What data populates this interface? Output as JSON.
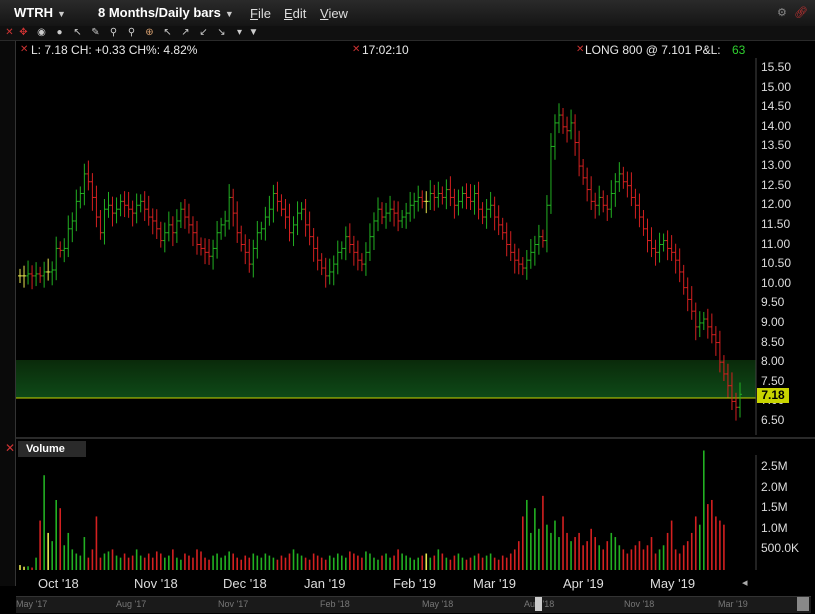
{
  "window": {
    "symbol": "WTRH",
    "period": "8 Months/Daily bars",
    "menus": [
      "File",
      "Edit",
      "View"
    ]
  },
  "toolbar": {
    "icons": [
      "close-icon",
      "crosshair-icon",
      "zoom-icon",
      "circle-icon",
      "cursor-icon",
      "draw-icon",
      "search-icon",
      "search-minus-icon",
      "globe-icon",
      "arrow-icon",
      "arrow-icon",
      "arrow-icon",
      "arrow-icon",
      "dropdown-icon"
    ]
  },
  "infobar": {
    "last": "L: 7.18 CH: +0.33 CH%: 4.82%",
    "time": "17:02:10",
    "position": "LONG 800 @ 7.101 P&L:",
    "pnl": "63"
  },
  "price_axis": [
    "15.50",
    "15.00",
    "14.50",
    "14.00",
    "13.50",
    "13.00",
    "12.50",
    "12.00",
    "11.50",
    "11.00",
    "10.50",
    "10.00",
    "9.50",
    "9.00",
    "8.50",
    "8.00",
    "7.50",
    "7.00",
    "6.50"
  ],
  "last_price_tag": "7.18",
  "volume": {
    "title": "Volume",
    "axis": [
      "2.5M",
      "2.0M",
      "1.5M",
      "1.0M",
      "500.0K"
    ]
  },
  "months": [
    "Oct '18",
    "Nov '18",
    "Dec '18",
    "Jan '19",
    "Feb '19",
    "Mar '19",
    "Apr '19",
    "May '19"
  ],
  "navigator_labels": [
    "May '17",
    "Aug '17",
    "Nov '17",
    "Feb '18",
    "May '18",
    "Aug '18",
    "Nov '18",
    "Mar '19"
  ],
  "colors": {
    "up": "#22b022",
    "down": "#d42020",
    "neutral": "#e8e850",
    "pnl": "#2fd02f",
    "highlight": "#c8d400"
  },
  "chart_data": {
    "type": "candlestick",
    "ylim": [
      6.4,
      15.7
    ],
    "close": [
      10.2,
      10.2,
      10.25,
      10.2,
      10.25,
      10.2,
      10.3,
      10.3,
      10.35,
      10.9,
      10.85,
      10.9,
      11.4,
      11.6,
      12.1,
      12.3,
      12.8,
      12.6,
      12.2,
      11.7,
      11.3,
      11.9,
      12.0,
      11.8,
      11.9,
      12.1,
      12.0,
      11.9,
      11.8,
      12.0,
      12.1,
      11.9,
      11.7,
      11.6,
      11.4,
      11.1,
      11.3,
      11.5,
      11.3,
      11.6,
      11.9,
      11.7,
      11.5,
      11.3,
      11.0,
      10.9,
      10.8,
      10.7,
      10.9,
      11.3,
      11.5,
      11.6,
      12.2,
      11.8,
      11.3,
      11.0,
      10.8,
      10.5,
      10.9,
      11.3,
      11.4,
      11.7,
      11.9,
      12.3,
      12.1,
      11.9,
      11.7,
      11.3,
      11.5,
      11.8,
      11.9,
      11.5,
      11.2,
      10.9,
      10.6,
      10.4,
      10.2,
      10.3,
      10.5,
      10.8,
      10.9,
      11.2,
      11.0,
      10.8,
      10.6,
      10.5,
      10.8,
      11.2,
      11.6,
      11.9,
      11.7,
      11.8,
      11.9,
      11.8,
      11.6,
      11.7,
      11.8,
      12.0,
      12.1,
      12.2,
      12.1,
      12.1,
      12.3,
      12.2,
      12.3,
      12.2,
      12.4,
      12.2,
      12.0,
      12.1,
      12.3,
      12.2,
      12.1,
      12.3,
      11.9,
      11.7,
      11.9,
      12.0,
      11.7,
      11.5,
      11.3,
      11.0,
      10.8,
      10.6,
      10.5,
      10.4,
      10.6,
      10.8,
      11.0,
      11.2,
      11.1,
      12.0,
      13.5,
      14.1,
      14.3,
      14.0,
      13.9,
      14.1,
      13.6,
      13.0,
      12.7,
      12.4,
      12.1,
      12.0,
      12.2,
      12.0,
      11.9,
      12.3,
      12.6,
      12.8,
      12.6,
      12.5,
      12.2,
      12.0,
      11.7,
      11.4,
      11.1,
      10.9,
      10.8,
      11.0,
      11.1,
      10.9,
      10.8,
      10.6,
      10.3,
      9.9,
      9.6,
      9.3,
      8.9,
      9.0,
      9.1,
      8.9,
      8.7,
      8.5,
      8.0,
      7.7,
      7.4,
      7.0,
      6.85,
      7.18
    ],
    "volume_k": [
      120,
      80,
      90,
      60,
      300,
      1200,
      2300,
      900,
      700,
      1700,
      1500,
      600,
      900,
      500,
      400,
      350,
      800,
      300,
      500,
      1300,
      300,
      400,
      450,
      500,
      350,
      300,
      400,
      300,
      350,
      500,
      350,
      300,
      400,
      300,
      450,
      400,
      300,
      350,
      500,
      300,
      250,
      400,
      350,
      300,
      500,
      450,
      300,
      250,
      350,
      400,
      300,
      350,
      450,
      400,
      300,
      250,
      350,
      300,
      400,
      350,
      300,
      400,
      350,
      300,
      250,
      350,
      300,
      400,
      500,
      400,
      350,
      300,
      250,
      400,
      350,
      300,
      250,
      350,
      300,
      400,
      350,
      300,
      450,
      400,
      350,
      300,
      450,
      400,
      300,
      250,
      350,
      400,
      300,
      350,
      500,
      400,
      350,
      300,
      250,
      300,
      350,
      400,
      300,
      350,
      500,
      400,
      300,
      250,
      350,
      400,
      300,
      250,
      300,
      350,
      400,
      300,
      350,
      400,
      300,
      250,
      350,
      300,
      400,
      500,
      700,
      1300,
      1700,
      900,
      1500,
      1000,
      1800,
      1100,
      900,
      1200,
      800,
      1300,
      900,
      700,
      800,
      900,
      600,
      700,
      1000,
      800,
      600,
      500,
      700,
      900,
      800,
      600,
      500,
      400,
      500,
      600,
      700,
      500,
      600,
      800,
      400,
      500,
      600,
      900,
      1200,
      500,
      400,
      600,
      700,
      900,
      1300,
      1100,
      2900,
      1600,
      1700,
      1300,
      1200,
      1100
    ],
    "ylabel": "",
    "xlabel": ""
  }
}
